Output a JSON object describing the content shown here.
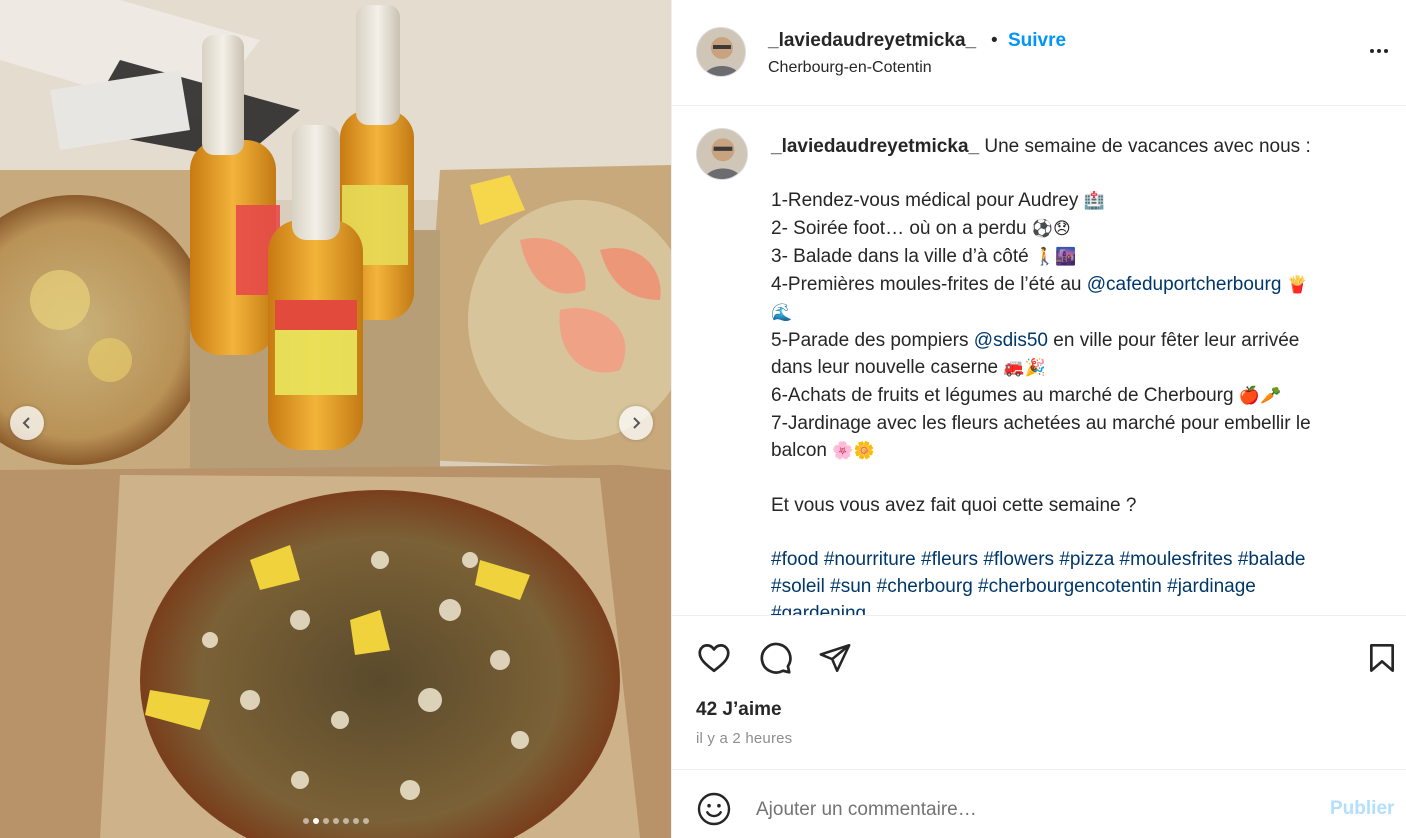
{
  "media": {
    "image": "pizza-boxes-and-beer-bottles",
    "carousel_dots": 7,
    "active_dot": 2
  },
  "header": {
    "username": "_laviedaudreyetmicka_",
    "separator": "•",
    "follow_label": "Suivre",
    "location": "Cherbourg-en-Cotentin"
  },
  "caption": {
    "username": "_laviedaudreyetmicka_",
    "intro": "Une semaine de vacances avec nous :",
    "l1": "1-Rendez-vous médical pour Audrey",
    "l1_emoji": "🏥",
    "l2": "2- Soirée foot… où on a perdu",
    "l2_emoji": "⚽😞",
    "l3": "3- Balade dans la ville d’à côté",
    "l3_emoji": "🚶🌆",
    "l4_pre": "4-Premières moules-frites de l’été au",
    "l4_mention": "@cafeduportcherbourg",
    "l4_emoji": "🍟",
    "l4_emoji2": "🌊",
    "l5_pre": "5-Parade des pompiers",
    "l5_mention": "@sdis50",
    "l5_post": "en ville pour fêter leur arrivée",
    "l5b": "dans leur nouvelle caserne",
    "l5b_emoji": "🚒🎉",
    "l6": "6-Achats de fruits et légumes au marché de Cherbourg",
    "l6_emoji": "🍎🥕",
    "l7": "7-Jardinage avec les fleurs achetées au marché pour embellir le",
    "l7b": "balcon",
    "l7b_emoji": "🌸🌼",
    "question": "Et vous vous avez fait quoi cette semaine ?",
    "tags_line1": [
      "#food",
      "#nourriture",
      "#fleurs",
      "#flowers",
      "#pizza",
      "#moulesfrites",
      "#balade"
    ],
    "tags_line2": [
      "#soleil",
      "#sun",
      "#cherbourg",
      "#cherbourgencotentin",
      "#jardinage"
    ],
    "tags_line3": [
      "#gardening"
    ]
  },
  "actions": {
    "like_icon": "heart-icon",
    "comment_icon": "comment-icon",
    "share_icon": "share-icon",
    "save_icon": "bookmark-icon",
    "likes": "42 J’aime",
    "timestamp": "il y a 2 heures"
  },
  "composer": {
    "emoji_icon": "smiley-icon",
    "placeholder": "Ajouter un commentaire…",
    "publish_label": "Publier"
  },
  "colors": {
    "link_blue": "#0095f6",
    "mention_blue": "#00376b",
    "publish_disabled": "#b2dffc",
    "text": "#262626",
    "muted": "#8e8e8e"
  }
}
